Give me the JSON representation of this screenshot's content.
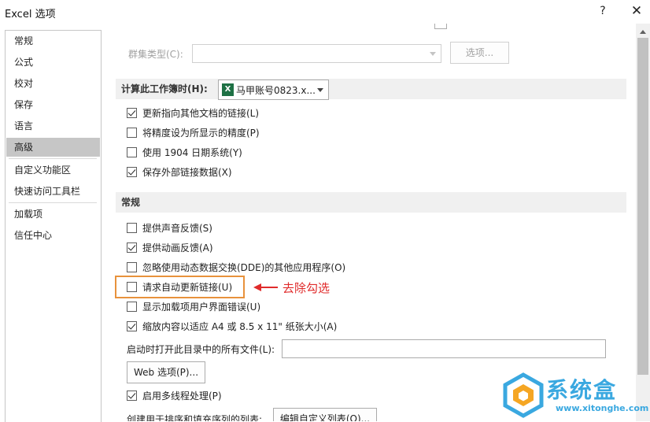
{
  "window": {
    "title": "Excel 选项",
    "help": "?",
    "close": "✕"
  },
  "sidebar": {
    "items": [
      {
        "label": "常规"
      },
      {
        "label": "公式"
      },
      {
        "label": "校对"
      },
      {
        "label": "保存"
      },
      {
        "label": "语言"
      },
      {
        "label": "高级",
        "selected": true
      },
      {
        "label": "自定义功能区"
      },
      {
        "label": "快速访问工具栏"
      },
      {
        "label": "加载项"
      },
      {
        "label": "信任中心"
      }
    ]
  },
  "cluster": {
    "label": "群集类型(C):",
    "value": "",
    "options_button": "选项..."
  },
  "calc_section": {
    "header_label": "计算此工作簿时(H):",
    "workbook": "马甲账号0823.x...",
    "workbook_icon": "excel-icon",
    "options": [
      {
        "label": "更新指向其他文档的链接(L)",
        "checked": true
      },
      {
        "label": "将精度设为所显示的精度(P)",
        "checked": false
      },
      {
        "label": "使用 1904 日期系统(Y)",
        "checked": false
      },
      {
        "label": "保存外部链接数据(X)",
        "checked": true
      }
    ]
  },
  "general_section": {
    "header": "常规",
    "options": [
      {
        "label": "提供声音反馈(S)",
        "checked": false
      },
      {
        "label": "提供动画反馈(A)",
        "checked": true
      },
      {
        "label": "忽略使用动态数据交换(DDE)的其他应用程序(O)",
        "checked": false
      },
      {
        "label": "请求自动更新链接(U)",
        "checked": false
      },
      {
        "label": "显示加载项用户界面错误(U)",
        "checked": false
      },
      {
        "label": "缩放内容以适应 A4 或 8.5 x 11\" 纸张大小(A)",
        "checked": true
      }
    ],
    "startup_label": "启动时打开此目录中的所有文件(L):",
    "startup_value": "",
    "web_options_button": "Web 选项(P)...",
    "multithread": {
      "label": "启用多线程处理(P)",
      "checked": true
    },
    "custom_list_label": "创建用于排序和填充序列的列表:",
    "custom_list_button": "编辑自定义列表(O)..."
  },
  "annotation": {
    "text": "去除勾选",
    "color": "#e02b2b",
    "box_color": "#e8923c"
  },
  "watermark": {
    "title": "系统盒",
    "url": "www.xitonghe.com"
  }
}
